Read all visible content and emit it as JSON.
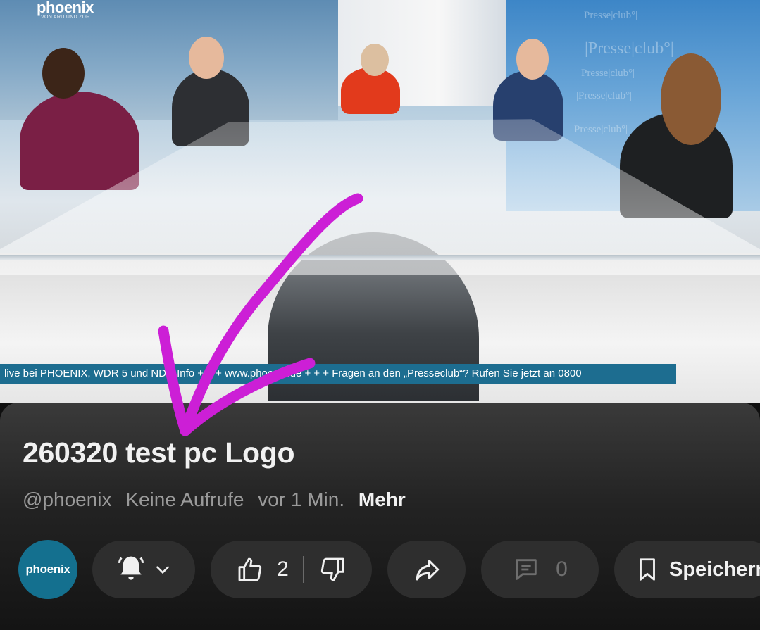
{
  "video": {
    "channel_logo_text": "phoenix",
    "channel_logo_sub": "VON ARD UND ZDF",
    "watermark_text": "|Presse|club°|",
    "ticker_text": "live bei PHOENIX, WDR 5 und NDR Info  + + +   www.phoenix.de   + + +    Fragen an den „Presseclub“?    Rufen Sie jetzt an 0800"
  },
  "video_info": {
    "title": "260320 test pc Logo",
    "channel_handle": "@phoenix",
    "views": "Keine Aufrufe",
    "age": "vor 1 Min.",
    "more_label": "Mehr"
  },
  "actions": {
    "avatar_text": "phoenix",
    "like_count": "2",
    "comment_count": "0",
    "save_label": "Speichern"
  },
  "icons": {
    "subscribe_bell": "bell-icon",
    "subscribe_dropdown": "chevron-down-icon",
    "like": "thumbs-up-icon",
    "dislike": "thumbs-down-icon",
    "share": "share-icon",
    "comments": "comment-icon",
    "save": "bookmark-icon"
  },
  "colors": {
    "annotation_arrow": "#cc1fd6",
    "ticker_bg": "#1d6d90",
    "avatar_bg": "#14708f"
  }
}
